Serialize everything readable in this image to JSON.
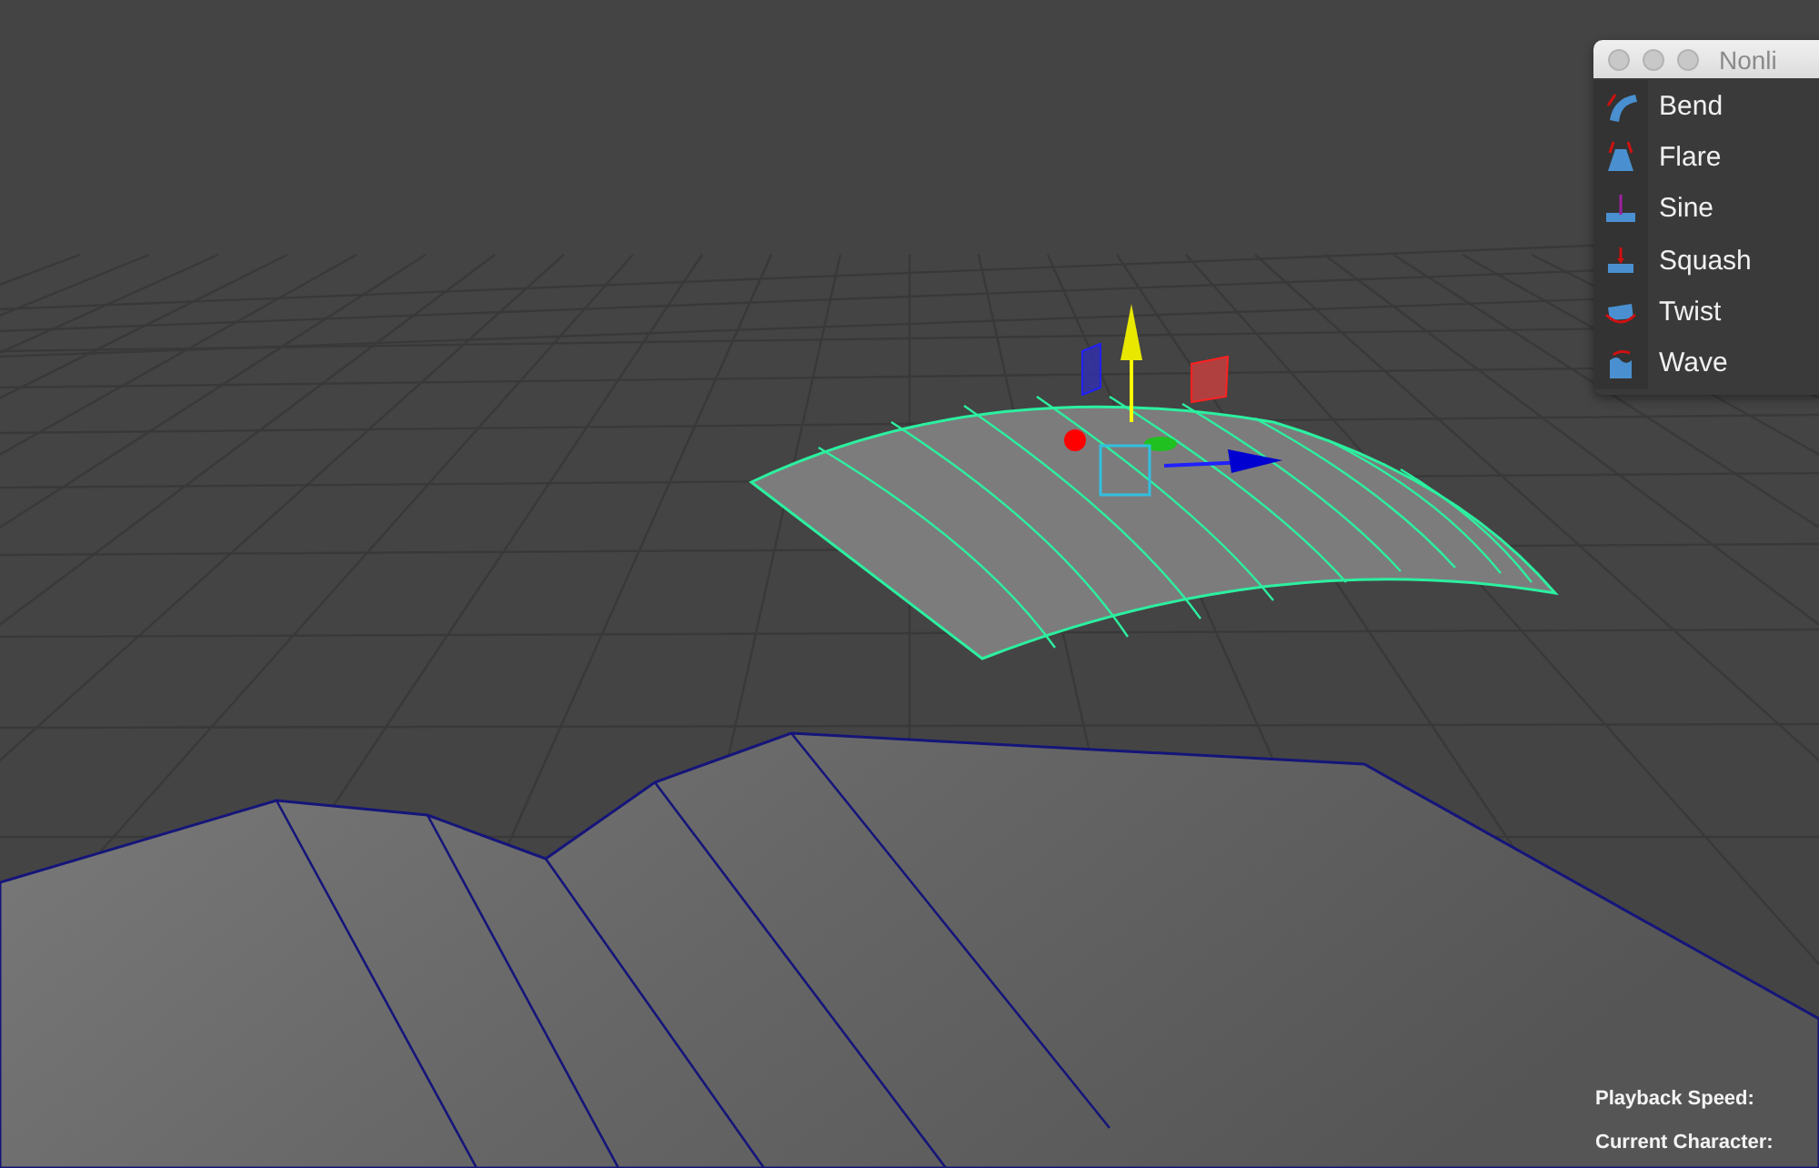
{
  "menu_window": {
    "title": "Nonli",
    "items": [
      {
        "label": "Bend"
      },
      {
        "label": "Flare"
      },
      {
        "label": "Sine"
      },
      {
        "label": "Squash"
      },
      {
        "label": "Twist"
      },
      {
        "label": "Wave"
      }
    ]
  },
  "status_labels": [
    "Playback Speed:",
    "Current Character:"
  ]
}
